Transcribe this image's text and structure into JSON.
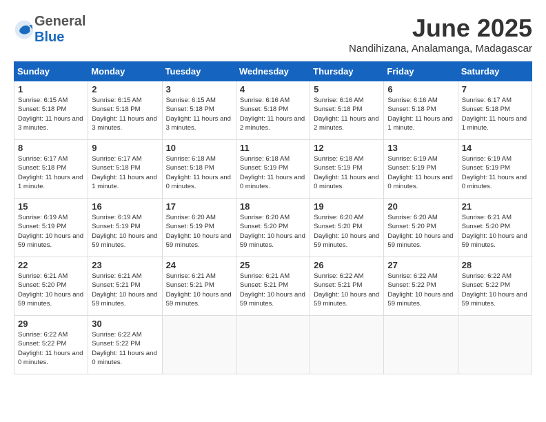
{
  "header": {
    "logo_general": "General",
    "logo_blue": "Blue",
    "month_title": "June 2025",
    "location": "Nandihizana, Analamanga, Madagascar"
  },
  "days_of_week": [
    "Sunday",
    "Monday",
    "Tuesday",
    "Wednesday",
    "Thursday",
    "Friday",
    "Saturday"
  ],
  "weeks": [
    [
      {
        "day": "1",
        "info": "Sunrise: 6:15 AM\nSunset: 5:18 PM\nDaylight: 11 hours and 3 minutes."
      },
      {
        "day": "2",
        "info": "Sunrise: 6:15 AM\nSunset: 5:18 PM\nDaylight: 11 hours and 3 minutes."
      },
      {
        "day": "3",
        "info": "Sunrise: 6:15 AM\nSunset: 5:18 PM\nDaylight: 11 hours and 3 minutes."
      },
      {
        "day": "4",
        "info": "Sunrise: 6:16 AM\nSunset: 5:18 PM\nDaylight: 11 hours and 2 minutes."
      },
      {
        "day": "5",
        "info": "Sunrise: 6:16 AM\nSunset: 5:18 PM\nDaylight: 11 hours and 2 minutes."
      },
      {
        "day": "6",
        "info": "Sunrise: 6:16 AM\nSunset: 5:18 PM\nDaylight: 11 hours and 1 minute."
      },
      {
        "day": "7",
        "info": "Sunrise: 6:17 AM\nSunset: 5:18 PM\nDaylight: 11 hours and 1 minute."
      }
    ],
    [
      {
        "day": "8",
        "info": "Sunrise: 6:17 AM\nSunset: 5:18 PM\nDaylight: 11 hours and 1 minute."
      },
      {
        "day": "9",
        "info": "Sunrise: 6:17 AM\nSunset: 5:18 PM\nDaylight: 11 hours and 1 minute."
      },
      {
        "day": "10",
        "info": "Sunrise: 6:18 AM\nSunset: 5:18 PM\nDaylight: 11 hours and 0 minutes."
      },
      {
        "day": "11",
        "info": "Sunrise: 6:18 AM\nSunset: 5:19 PM\nDaylight: 11 hours and 0 minutes."
      },
      {
        "day": "12",
        "info": "Sunrise: 6:18 AM\nSunset: 5:19 PM\nDaylight: 11 hours and 0 minutes."
      },
      {
        "day": "13",
        "info": "Sunrise: 6:19 AM\nSunset: 5:19 PM\nDaylight: 11 hours and 0 minutes."
      },
      {
        "day": "14",
        "info": "Sunrise: 6:19 AM\nSunset: 5:19 PM\nDaylight: 11 hours and 0 minutes."
      }
    ],
    [
      {
        "day": "15",
        "info": "Sunrise: 6:19 AM\nSunset: 5:19 PM\nDaylight: 10 hours and 59 minutes."
      },
      {
        "day": "16",
        "info": "Sunrise: 6:19 AM\nSunset: 5:19 PM\nDaylight: 10 hours and 59 minutes."
      },
      {
        "day": "17",
        "info": "Sunrise: 6:20 AM\nSunset: 5:19 PM\nDaylight: 10 hours and 59 minutes."
      },
      {
        "day": "18",
        "info": "Sunrise: 6:20 AM\nSunset: 5:20 PM\nDaylight: 10 hours and 59 minutes."
      },
      {
        "day": "19",
        "info": "Sunrise: 6:20 AM\nSunset: 5:20 PM\nDaylight: 10 hours and 59 minutes."
      },
      {
        "day": "20",
        "info": "Sunrise: 6:20 AM\nSunset: 5:20 PM\nDaylight: 10 hours and 59 minutes."
      },
      {
        "day": "21",
        "info": "Sunrise: 6:21 AM\nSunset: 5:20 PM\nDaylight: 10 hours and 59 minutes."
      }
    ],
    [
      {
        "day": "22",
        "info": "Sunrise: 6:21 AM\nSunset: 5:20 PM\nDaylight: 10 hours and 59 minutes."
      },
      {
        "day": "23",
        "info": "Sunrise: 6:21 AM\nSunset: 5:21 PM\nDaylight: 10 hours and 59 minutes."
      },
      {
        "day": "24",
        "info": "Sunrise: 6:21 AM\nSunset: 5:21 PM\nDaylight: 10 hours and 59 minutes."
      },
      {
        "day": "25",
        "info": "Sunrise: 6:21 AM\nSunset: 5:21 PM\nDaylight: 10 hours and 59 minutes."
      },
      {
        "day": "26",
        "info": "Sunrise: 6:22 AM\nSunset: 5:21 PM\nDaylight: 10 hours and 59 minutes."
      },
      {
        "day": "27",
        "info": "Sunrise: 6:22 AM\nSunset: 5:22 PM\nDaylight: 10 hours and 59 minutes."
      },
      {
        "day": "28",
        "info": "Sunrise: 6:22 AM\nSunset: 5:22 PM\nDaylight: 10 hours and 59 minutes."
      }
    ],
    [
      {
        "day": "29",
        "info": "Sunrise: 6:22 AM\nSunset: 5:22 PM\nDaylight: 11 hours and 0 minutes."
      },
      {
        "day": "30",
        "info": "Sunrise: 6:22 AM\nSunset: 5:22 PM\nDaylight: 11 hours and 0 minutes."
      },
      {
        "day": "",
        "info": ""
      },
      {
        "day": "",
        "info": ""
      },
      {
        "day": "",
        "info": ""
      },
      {
        "day": "",
        "info": ""
      },
      {
        "day": "",
        "info": ""
      }
    ]
  ]
}
